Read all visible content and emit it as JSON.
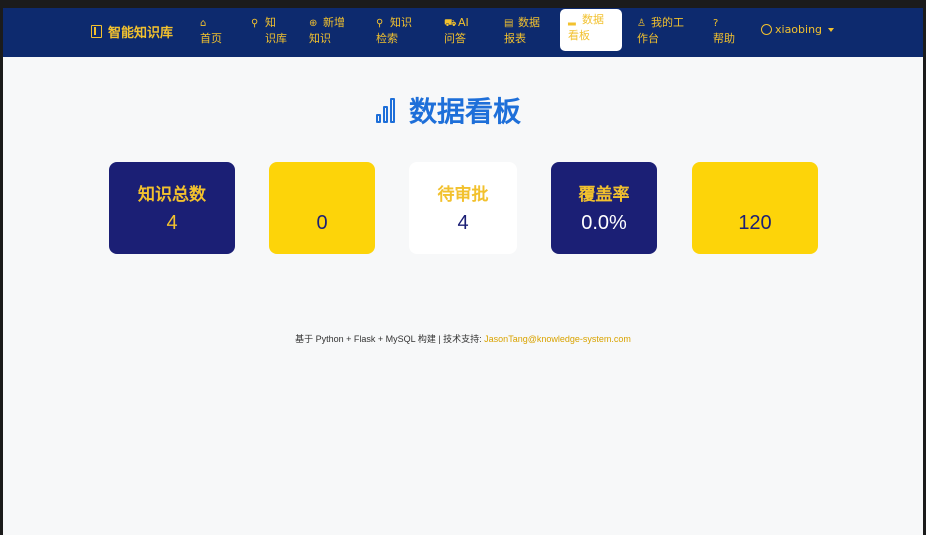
{
  "brand": {
    "name": "智能知识库",
    "icon": "book-icon"
  },
  "nav": {
    "items": [
      {
        "icon": "home-icon",
        "glyph": "⌂",
        "line1": "",
        "line2": "首页"
      },
      {
        "icon": "search-icon",
        "glyph": "⚲",
        "line1": "知",
        "line2": "识库"
      },
      {
        "icon": "plus-circle-icon",
        "glyph": "⊕",
        "line1": "新增",
        "line2": "知识"
      },
      {
        "icon": "search-icon",
        "glyph": "⚲",
        "line1": "知识",
        "line2": "检索"
      },
      {
        "icon": "robot-icon",
        "glyph": "⛟",
        "line1": "AI",
        "line2": "问答"
      },
      {
        "icon": "report-icon",
        "glyph": "▤",
        "line1": "数据",
        "line2": "报表"
      },
      {
        "icon": "bar-chart-icon",
        "glyph": "▂",
        "line1": "数据",
        "line2": "看板"
      },
      {
        "icon": "person-icon",
        "glyph": "♙",
        "line1": "我的工",
        "line2": "作台"
      },
      {
        "icon": "help-icon",
        "glyph": "?",
        "line1": "",
        "line2": "帮助"
      }
    ],
    "user": "xiaobing"
  },
  "page": {
    "title": "数据看板",
    "icon": "bar-chart-icon"
  },
  "cards": [
    {
      "label": "知识总数",
      "value": "4"
    },
    {
      "label": "",
      "value": "0"
    },
    {
      "label": "待审批",
      "value": "4"
    },
    {
      "label": "覆盖率",
      "value": "0.0%"
    },
    {
      "label": "",
      "value": "120"
    }
  ],
  "footer": {
    "text": "基于 Python + Flask + MySQL 构建 | 技术支持: ",
    "email": "JasonTang@knowledge-system.com"
  },
  "colors": {
    "navbar": "#0d2a6e",
    "accent": "#f2c12e",
    "title": "#1e6fd9",
    "navy_card": "#1b1f75",
    "yellow_card": "#fdd409"
  }
}
